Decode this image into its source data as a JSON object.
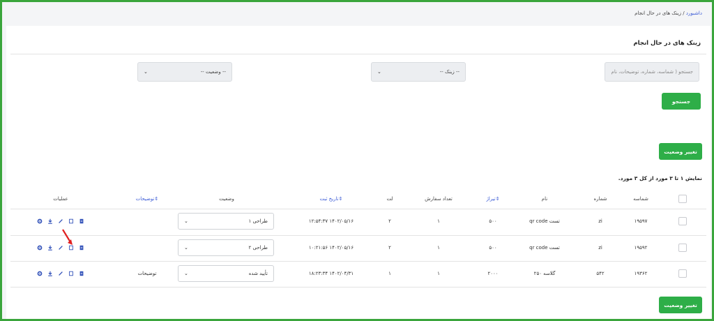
{
  "breadcrumb": {
    "home": "داشبورد",
    "separator": "/",
    "current": "زینک های در حال انجام"
  },
  "page_title": "زینک های در حال انجام",
  "filters": {
    "search_placeholder": "جستجو ( شماسه، شماره، توضیحات، نام )",
    "zinc_select": "-- زینک --",
    "status_select": "-- وضعیت --",
    "search_button": "جستجو"
  },
  "change_status_button": "تغییر وضعیت",
  "summary": {
    "prefix": "نمایش",
    "range": "۱ تا ۳",
    "middle": "مورد از کل",
    "total": "۳",
    "suffix": "مورد."
  },
  "table": {
    "columns": {
      "id": "شماسه",
      "number": "شماره",
      "name": "نام",
      "circulation": "تیراژ",
      "order_count": "تعداد سفارش",
      "lot": "لت",
      "created_at": "تاریخ ثبت",
      "status": "وضعیت",
      "description": "توضیحات",
      "operations": "عملیات"
    },
    "rows": [
      {
        "id": "۱۹۵۹۷",
        "number": "zi",
        "name": "تست qr code",
        "circulation": "۵۰۰",
        "order_count": "۱",
        "lot": "۲",
        "created_at": "۱۴۰۲/۰۵/۱۶ ۱۲:۵۴:۳۷",
        "status": "طراحی ۱",
        "description": ""
      },
      {
        "id": "۱۹۵۹۲",
        "number": "zi",
        "name": "تست qr code",
        "circulation": "۵۰۰",
        "order_count": "۱",
        "lot": "۲",
        "created_at": "۱۴۰۲/۰۵/۱۶ ۱۰:۲۱:۵۶",
        "status": "طراحی ۲",
        "description": ""
      },
      {
        "id": "۱۹۳۶۲",
        "number": "۵۴۲",
        "name": "گلاسه ۲۵۰",
        "circulation": "۲۰۰۰",
        "order_count": "۱",
        "lot": "۱",
        "created_at": "۱۴۰۲/۰۴/۳۱ ۱۸:۲۳:۳۴",
        "status": "تأیید شده",
        "description": "توضیحات"
      }
    ]
  },
  "icons": {
    "operations": [
      "gear-icon",
      "download-icon",
      "pencil-icon",
      "document-icon",
      "clipboard-icon"
    ],
    "select_chevron": "chevron-down-icon",
    "annotation": "red-arrow-icon"
  },
  "colors": {
    "frame": "#3aa53c",
    "button": "#2eae48",
    "link": "#3b5bd6",
    "annotation_arrow": "#e02020"
  }
}
